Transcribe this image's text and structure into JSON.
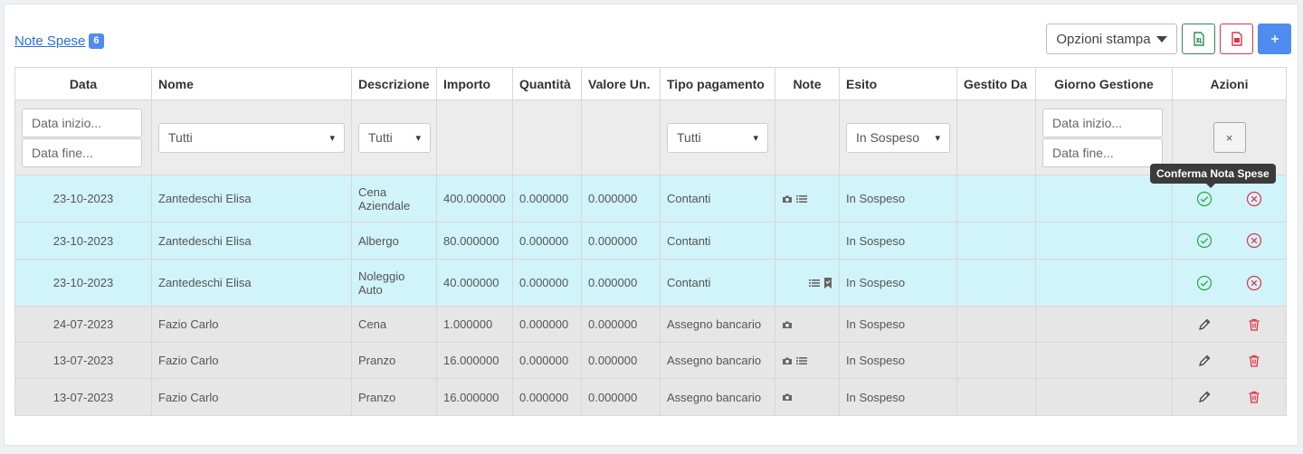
{
  "page": {
    "title": "Note Spese",
    "count": "6"
  },
  "toolbar": {
    "print_label": "Opzioni stampa"
  },
  "columns": [
    "Data",
    "Nome",
    "Descrizione",
    "Importo",
    "Quantità",
    "Valore Un.",
    "Tipo pagamento",
    "Note",
    "Esito",
    "Gestito Da",
    "Giorno Gestione",
    "Azioni"
  ],
  "filters": {
    "data_start_placeholder": "Data inizio...",
    "data_end_placeholder": "Data fine...",
    "nome_value": "Tutti",
    "descrizione_value": "Tutti",
    "tipo_value": "Tutti",
    "esito_value": "In Sospeso",
    "giorno_start_placeholder": "Data inizio...",
    "giorno_end_placeholder": "Data fine..."
  },
  "tooltip": "Conferma Nota Spese",
  "rows": [
    {
      "data": "23-10-2023",
      "nome": "Zantedeschi Elisa",
      "descrizione": "Cena Aziendale",
      "importo": "400.000000",
      "quantita": "0.000000",
      "valore": "0.000000",
      "tipo": "Contanti",
      "esito": "In Sospeso",
      "note_icons": [
        "camera-icon",
        "list-icon"
      ]
    },
    {
      "data": "23-10-2023",
      "nome": "Zantedeschi Elisa",
      "descrizione": "Albergo",
      "importo": "80.000000",
      "quantita": "0.000000",
      "valore": "0.000000",
      "tipo": "Contanti",
      "esito": "In Sospeso",
      "note_icons": []
    },
    {
      "data": "23-10-2023",
      "nome": "Zantedeschi Elisa",
      "descrizione": "Noleggio Auto",
      "importo": "40.000000",
      "quantita": "0.000000",
      "valore": "0.000000",
      "tipo": "Contanti",
      "esito": "In Sospeso",
      "note_icons": [
        "list-icon",
        "bookmark-icon"
      ]
    },
    {
      "data": "24-07-2023",
      "nome": "Fazio Carlo",
      "descrizione": "Cena",
      "importo": "1.000000",
      "quantita": "0.000000",
      "valore": "0.000000",
      "tipo": "Assegno bancario",
      "esito": "In Sospeso",
      "note_icons": [
        "camera-icon"
      ]
    },
    {
      "data": "13-07-2023",
      "nome": "Fazio Carlo",
      "descrizione": "Pranzo",
      "importo": "16.000000",
      "quantita": "0.000000",
      "valore": "0.000000",
      "tipo": "Assegno bancario",
      "esito": "In Sospeso",
      "note_icons": [
        "camera-icon",
        "list-icon"
      ]
    },
    {
      "data": "13-07-2023",
      "nome": "Fazio Carlo",
      "descrizione": "Pranzo",
      "importo": "16.000000",
      "quantita": "0.000000",
      "valore": "0.000000",
      "tipo": "Assegno bancario",
      "esito": "In Sospeso",
      "note_icons": [
        "camera-icon"
      ]
    }
  ],
  "colors": {
    "pending_row": "#d1f3fa",
    "regular_row": "#e6e6e6",
    "confirm": "#28a745",
    "reject": "#dc3545",
    "accent": "#4f8cf0"
  }
}
